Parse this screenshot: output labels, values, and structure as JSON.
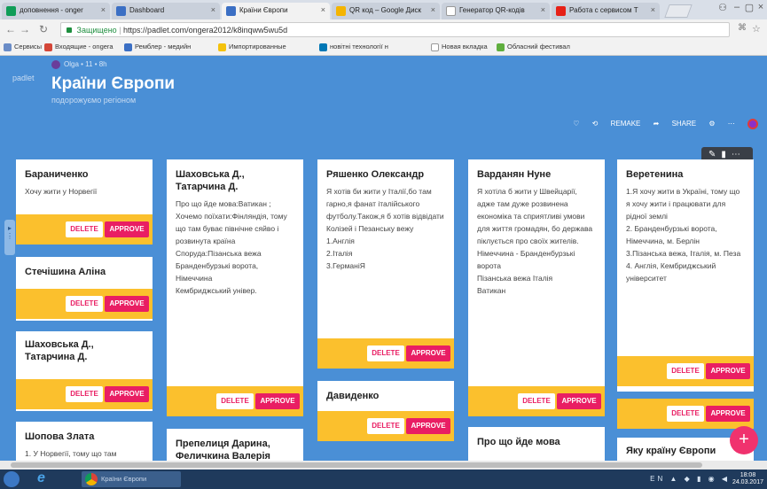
{
  "browser": {
    "tabs": [
      {
        "label": "доповнення - onger",
        "icon": "sheets-icon",
        "active": false
      },
      {
        "label": "Dashboard",
        "icon": "padlet-icon",
        "active": false
      },
      {
        "label": "Країни Європи",
        "icon": "padlet-icon",
        "active": true
      },
      {
        "label": "QR код – Google Диск",
        "icon": "drive-icon",
        "active": false
      },
      {
        "label": "Генератор QR-кодів",
        "icon": "page-icon",
        "active": false
      },
      {
        "label": "Работа с сервисом Т",
        "icon": "youtube-icon",
        "active": false
      }
    ],
    "address": {
      "secure_label": "Защищено",
      "url": "https://padlet.com/ongera2012/k8inqww5wu5d"
    },
    "bookmarks": [
      {
        "label": "Сервисы",
        "color": "#6a8cc7"
      },
      {
        "label": "Входящие - ongera",
        "color": "#d44638"
      },
      {
        "label": "Ремблер - медийн",
        "color": "#3b6fc4"
      },
      {
        "label": "Импортированные",
        "color": "#f4c20d"
      },
      {
        "label": "новітні технології н",
        "color": "#0077b5"
      },
      {
        "label": "Новая вкладка",
        "color": "#cccccc"
      },
      {
        "label": "Обласний фестивал",
        "color": "#5fae3e"
      }
    ]
  },
  "padlet": {
    "logo": "padlet",
    "author": "Olga",
    "likes": "• 11 •",
    "time": "8h",
    "title": "Країни Європи",
    "subtitle": "подорожуємо регіоном",
    "actions": {
      "remake": "REMAKE",
      "share": "SHARE"
    },
    "delete_label": "DELETE",
    "approve_label": "APPROVE",
    "columns": [
      [
        {
          "title": "Бараниченко",
          "body": "Хочу жити у Норвегії"
        },
        {
          "title": "Стечішина Аліна",
          "body": ""
        },
        {
          "title": "Шаховська Д., Татарчина Д.",
          "body": ""
        },
        {
          "title": "Шопова Злата",
          "body": "1. У Норвегії, тому що там"
        }
      ],
      [
        {
          "title": "Шаховська Д., Татарчина Д.",
          "body": "Про що йде мова:Ватикан ;\nХочемо поїхати:Фінляндія, тому що там буває північне сяйво і розвинута країна\nСпоруда:Пізанська вежа Бранденбурзькі ворота, Німеччина\nКембриджський універ."
        },
        {
          "title": "Препелиця Дарина, Феличкина Валерія",
          "body": ""
        }
      ],
      [
        {
          "title": "Ряшенко Олександр",
          "body": "Я хотів би жити у Італії,бо там гарно,я фанат італійського футболу.Також,я б хотів відвідати Колізей і Пезанську вежу\n1.Англія\n2.Італія\n3.ГерманіЯ"
        },
        {
          "title": "Давиденко",
          "body": ""
        }
      ],
      [
        {
          "title": "Варданян Нуне",
          "body": "Я хотіла б жити у Швейцарії, адже там дуже розвинена економіка та сприятливі умови для життя громадян, бо держава піклується про своїх жителів.\nНімеччина - Бранденбурзькі ворота\nПізанська вежа Італія\nВатикан"
        },
        {
          "title": "Про що йде мова",
          "body": ""
        }
      ],
      [
        {
          "title": "Веретенина",
          "body": "1.Я хочу жити в Україні, тому що я хочу жити і працювати для рідної землі\n2. Бранденбурзькі ворота, Німеччина, м. Берлін\n3.Пізанська вежа, Італія, м. Пеза\n4. Англія, Кембриджський університет"
        },
        {
          "title": "",
          "body": ""
        },
        {
          "title": "Яку країну Європи",
          "body": ""
        }
      ]
    ]
  },
  "taskbar": {
    "window_label": "Країни Європи",
    "tray": "EN",
    "time": "18:08",
    "date": "24.03.2017"
  }
}
